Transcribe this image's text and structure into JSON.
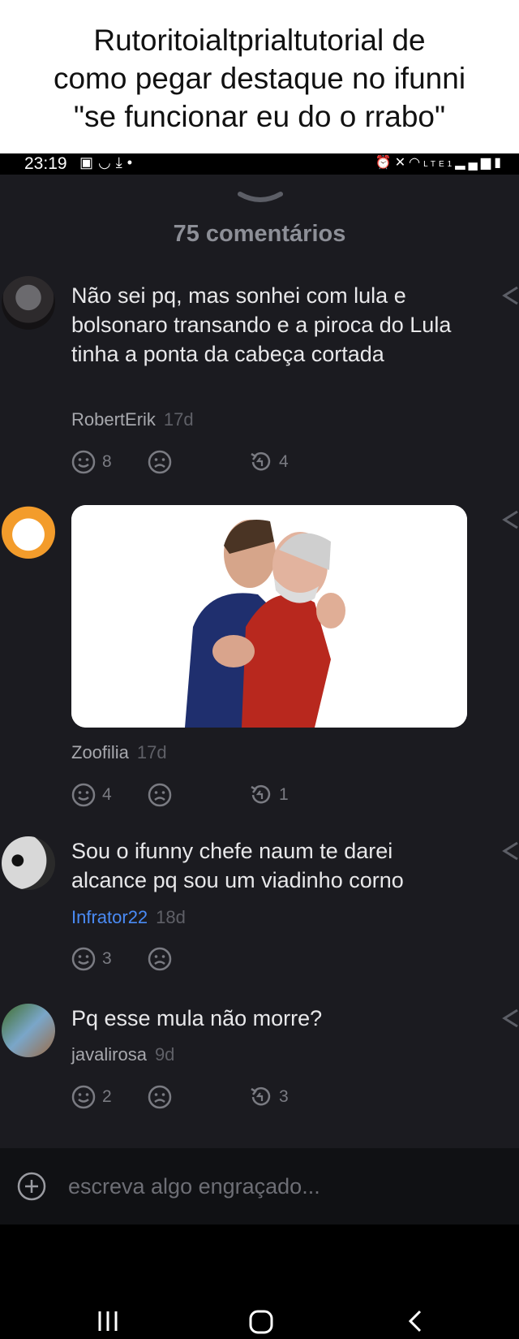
{
  "caption": {
    "line1": "Rutoritoialtprialtutorial de",
    "line2": "como pegar destaque no ifunni",
    "line3": "\"se funcionar eu do o rrabo\""
  },
  "status_bar": {
    "time": "23:19",
    "left_icons": [
      "image-icon",
      "smile-icon",
      "download-icon",
      "dot-icon"
    ],
    "right_icons": [
      "alarm-icon",
      "mute-icon",
      "wifi-icon",
      "volte-icon",
      "signal-icon",
      "battery-icon"
    ],
    "network_label": "LTE1"
  },
  "comments_header": "75 comentários",
  "comments": [
    {
      "text": "Não sei pq, mas sonhei com lula e bolsonaro transando e a piroca do Lula tinha a ponta da cabeça cortada",
      "user": "RobertErik",
      "age": "17d",
      "likes": "8",
      "replies": "4"
    },
    {
      "image": "kissing-politicians-image",
      "user": "Zoofilia",
      "age": "17d",
      "likes": "4",
      "replies": "1"
    },
    {
      "text": "Sou o ifunny chefe naum te darei alcance pq sou um viadinho corno",
      "user": "Infrator22",
      "age": "18d",
      "likes": "3",
      "user_color": "#4a8bf5"
    },
    {
      "text": "Pq esse mula não morre?",
      "user": "javalirosa",
      "age": "9d",
      "likes": "2",
      "replies": "3"
    }
  ],
  "input": {
    "placeholder": "escreva algo engraçado..."
  },
  "colors": {
    "background": "#1b1b20",
    "accent_user": "#4a8bf5",
    "muted": "#7a7b82"
  }
}
